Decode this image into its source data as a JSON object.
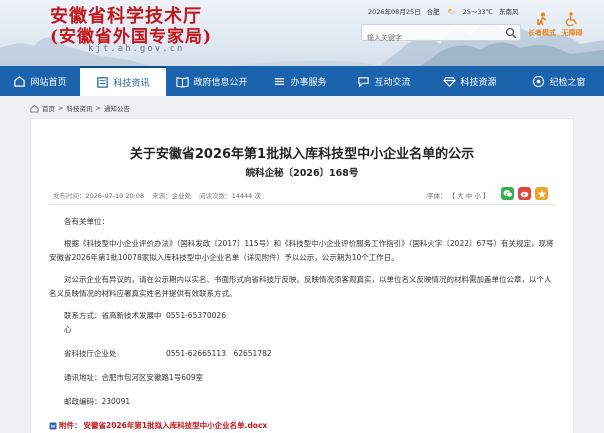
{
  "header": {
    "title_line1": "安徽省科学技术厅",
    "title_line2": "(安徽省外国专家局)",
    "url": "kjt.ah.gov.cn",
    "date": "2026年08月25日",
    "city": "合肥",
    "temperature": "25～33℃",
    "wind": "东南风",
    "weather_icon": "cloud-sun-icon",
    "search_placeholder": "输入关键字",
    "tools": [
      {
        "label": "长者模式",
        "icon": "elder-mode-icon"
      },
      {
        "label": "无障碍",
        "icon": "accessibility-icon"
      }
    ]
  },
  "nav": {
    "items": [
      {
        "label": "网站首页",
        "icon": "home-icon"
      },
      {
        "label": "科技资讯",
        "icon": "news-icon",
        "active": true
      },
      {
        "label": "政府信息公开",
        "icon": "book-icon"
      },
      {
        "label": "办事服务",
        "icon": "service-icon"
      },
      {
        "label": "互动交流",
        "icon": "chat-icon"
      },
      {
        "label": "科技资源",
        "icon": "diamond-icon"
      },
      {
        "label": "纪检之窗",
        "icon": "eye-icon"
      }
    ]
  },
  "breadcrumb": {
    "items": [
      "首页",
      "科技资讯",
      "通知公告"
    ],
    "separator": ">"
  },
  "article": {
    "title": "关于安徽省2026年第1批拟入库科技型中小企业名单的公示",
    "doc_number": "皖科企秘〔2026〕168号",
    "meta": {
      "publish_label": "发布时间：",
      "publish_time": "2026-07-10 20:08",
      "source_label": "来源：",
      "source": "企业处",
      "views_label": "阅读次数：",
      "views": "14444 次"
    },
    "font_size": {
      "label": "字体：",
      "open": "【",
      "large": "大",
      "medium": "中",
      "small": "小",
      "close": "】"
    },
    "share_icons": [
      "wechat-icon",
      "weibo-icon",
      "favorite-icon"
    ],
    "salutation": "各有关单位：",
    "para1": "根据《科技型中小企业评价办法》（国科发政〔2017〕115号）和《科技型中小企业评价服务工作指引》（国科火字〔2022〕67号）有关规定，现将安徽省2026年第1批10078家拟入库科技型中小企业名单（详见附件）予以公示，公示期为10个工作日。",
    "para2": "对公示企业有异议的，请在公示期内以实名、书面形式向省科技厅反映。反映情况须客观真实，以单位名义反映情况的材料需加盖单位公章，以个人名义反映情况的材料应署真实姓名并提供有效联系方式。",
    "contact_label": "联系方式：",
    "contact_org": "省高新技术发展中心",
    "contact_phone": "0551-65370026",
    "dept": "省科技厅企业处",
    "dept_phone": "0551-62665113　62651782",
    "address_label": "通讯地址：",
    "address": "合肥市包河区安徽路1号609室",
    "postcode_label": "邮政编码：",
    "postcode": "230091",
    "attachment_label": "附件：",
    "attachment_name": "安徽省2026年第1批拟入库科技型中小企业名单.docx"
  },
  "colors": {
    "brand_red": "#c3161c",
    "nav_blue": "#1b63ad",
    "accent_orange": "#e8861a"
  }
}
